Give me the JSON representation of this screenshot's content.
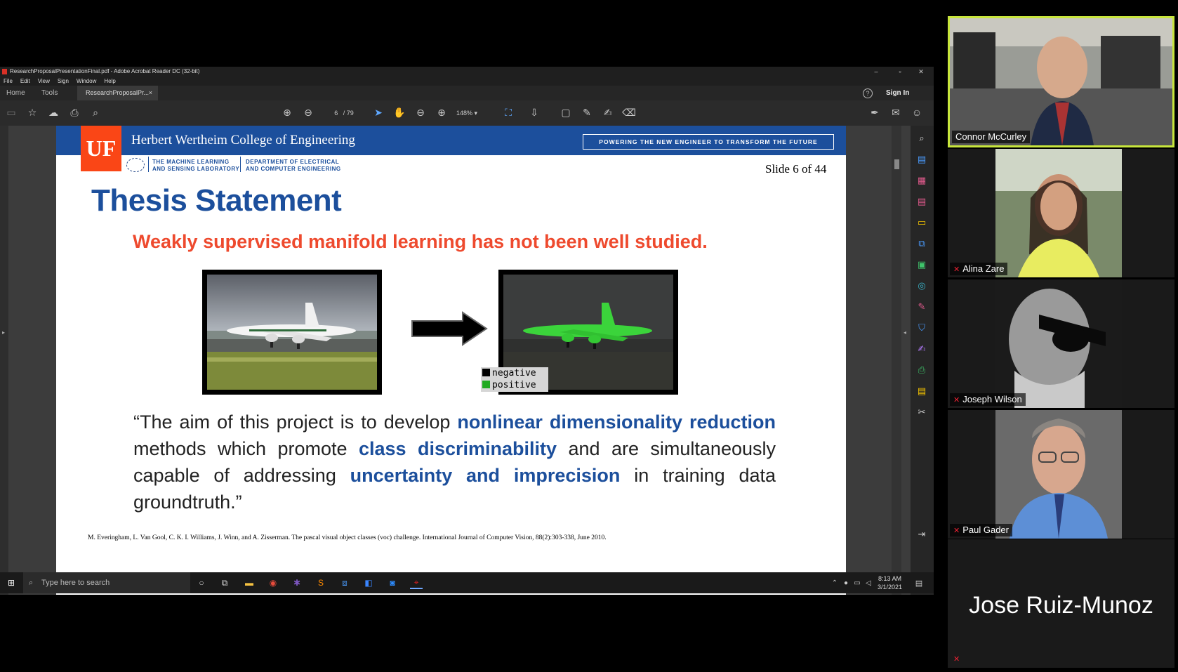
{
  "window": {
    "title": "ResearchProposalPresentationFinal.pdf - Adobe Acrobat Reader DC (32-bit)",
    "menu": [
      "File",
      "Edit",
      "View",
      "Sign",
      "Window",
      "Help"
    ],
    "controls": {
      "minimize": "–",
      "maximize": "▫",
      "close": "✕"
    }
  },
  "tabs": {
    "home": "Home",
    "tools": "Tools",
    "document": "ResearchProposalPr...",
    "close": "×",
    "help": "?",
    "sign_in": "Sign In"
  },
  "toolbar": {
    "page_current": "6",
    "page_total": "/ 79",
    "zoom": "148%",
    "icons": [
      "save-icon",
      "bookmark-star-icon",
      "upload-icon",
      "print-icon",
      "search-icon",
      "page-up-icon",
      "page-down-icon",
      "select-cursor-icon",
      "hand-icon",
      "zoom-out-icon",
      "zoom-in-icon",
      "fit-page-icon",
      "scroll-mode-icon",
      "comment-icon",
      "highlight-pen-icon",
      "draw-icon",
      "erase-icon",
      "sign-icon",
      "email-icon",
      "share-user-icon"
    ]
  },
  "slide": {
    "college": "Herbert Wertheim College of Engineering",
    "tagline": "POWERING THE NEW ENGINEER TO TRANSFORM THE FUTURE",
    "logo": "UF",
    "dept1_line1": "THE MACHINE LEARNING",
    "dept1_line2": "AND SENSING LABORATORY",
    "dept2_line1": "DEPARTMENT OF ELECTRICAL",
    "dept2_line2": "AND COMPUTER ENGINEERING",
    "slide_number": "Slide 6 of 44",
    "title": "Thesis Statement",
    "subtitle": "Weakly supervised manifold learning has not been well studied.",
    "legend": {
      "negative": "negative",
      "positive": "positive",
      "negative_color": "#000000",
      "positive_color": "#22aa22"
    },
    "quote": {
      "p1": "“The aim of this project is to develop ",
      "h1": "nonlinear dimensionality reduction",
      "p2": " methods which promote ",
      "h2": "class discriminability",
      "p3": " and are simultaneously capable of addressing ",
      "h3": "uncertainty and imprecision",
      "p4": " in training data groundtruth.”"
    },
    "citation": "M. Everingham, L. Van Gool, C. K. I. Williams, J. Winn, and A. Zisserman. The pascal visual object classes (voc) challenge. International Journal of Computer Vision, 88(2):303-338, June 2010."
  },
  "taskbar": {
    "search_placeholder": "Type here to search",
    "time": "8:13 AM",
    "date": "3/1/2021"
  },
  "participants": [
    {
      "name": "Connor McCurley",
      "active_speaker": true,
      "muted": false
    },
    {
      "name": "Alina Zare",
      "muted": true
    },
    {
      "name": "Joseph Wilson",
      "muted": true
    },
    {
      "name": "Paul Gader",
      "muted": true
    },
    {
      "name": "Jose Ruiz-Munoz",
      "muted": true,
      "video": false
    }
  ],
  "colors": {
    "uf_blue": "#1c4f9c",
    "uf_orange": "#fa4616",
    "subtitle_red": "#ee4a2e",
    "active_speaker_border": "#c8e63c"
  }
}
